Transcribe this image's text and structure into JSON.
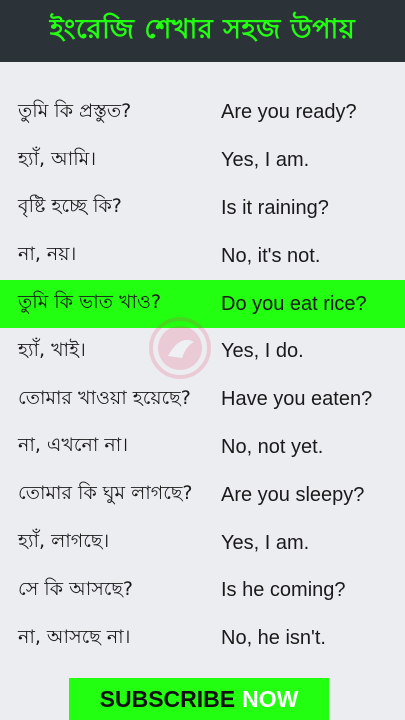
{
  "header": {
    "title": "ইংরেজি শেখার সহজ উপায়"
  },
  "phrases": [
    {
      "bn": "তুমি কি প্রস্তুত?",
      "en": "Are you ready?"
    },
    {
      "bn": "হ্যাঁ, আমি।",
      "en": "Yes, I am."
    },
    {
      "bn": "বৃষ্টি হচ্ছে কি?",
      "en": "Is it raining?"
    },
    {
      "bn": "না, নয়।",
      "en": "No, it's not."
    },
    {
      "bn": "তুমি কি ভাত খাও?",
      "en": "Do you eat rice?",
      "highlighted": true
    },
    {
      "bn": "হ্যাঁ, খাই।",
      "en": "Yes, I do."
    },
    {
      "bn": "তোমার খাওয়া হয়েছে?",
      "en": "Have you eaten?"
    },
    {
      "bn": "না, এখনো না।",
      "en": "No, not yet."
    },
    {
      "bn": "তোমার কি ঘুম লাগছে?",
      "en": "Are you sleepy?"
    },
    {
      "bn": "হ্যাঁ, লাগছে।",
      "en": "Yes, I am."
    },
    {
      "bn": "সে কি আসছে?",
      "en": "Is he coming?"
    },
    {
      "bn": "না, আসছে না।",
      "en": "No, he isn't."
    }
  ],
  "subscribe": {
    "label_part1": "SUBSCRIBE",
    "label_part2": "NOW"
  },
  "colors": {
    "header_bg": "#2b3338",
    "accent_green": "#22ff11",
    "page_bg": "#ecedf1",
    "watermark": "#e0315a"
  },
  "icons": {
    "watermark": "channel-logo-watermark-icon"
  }
}
